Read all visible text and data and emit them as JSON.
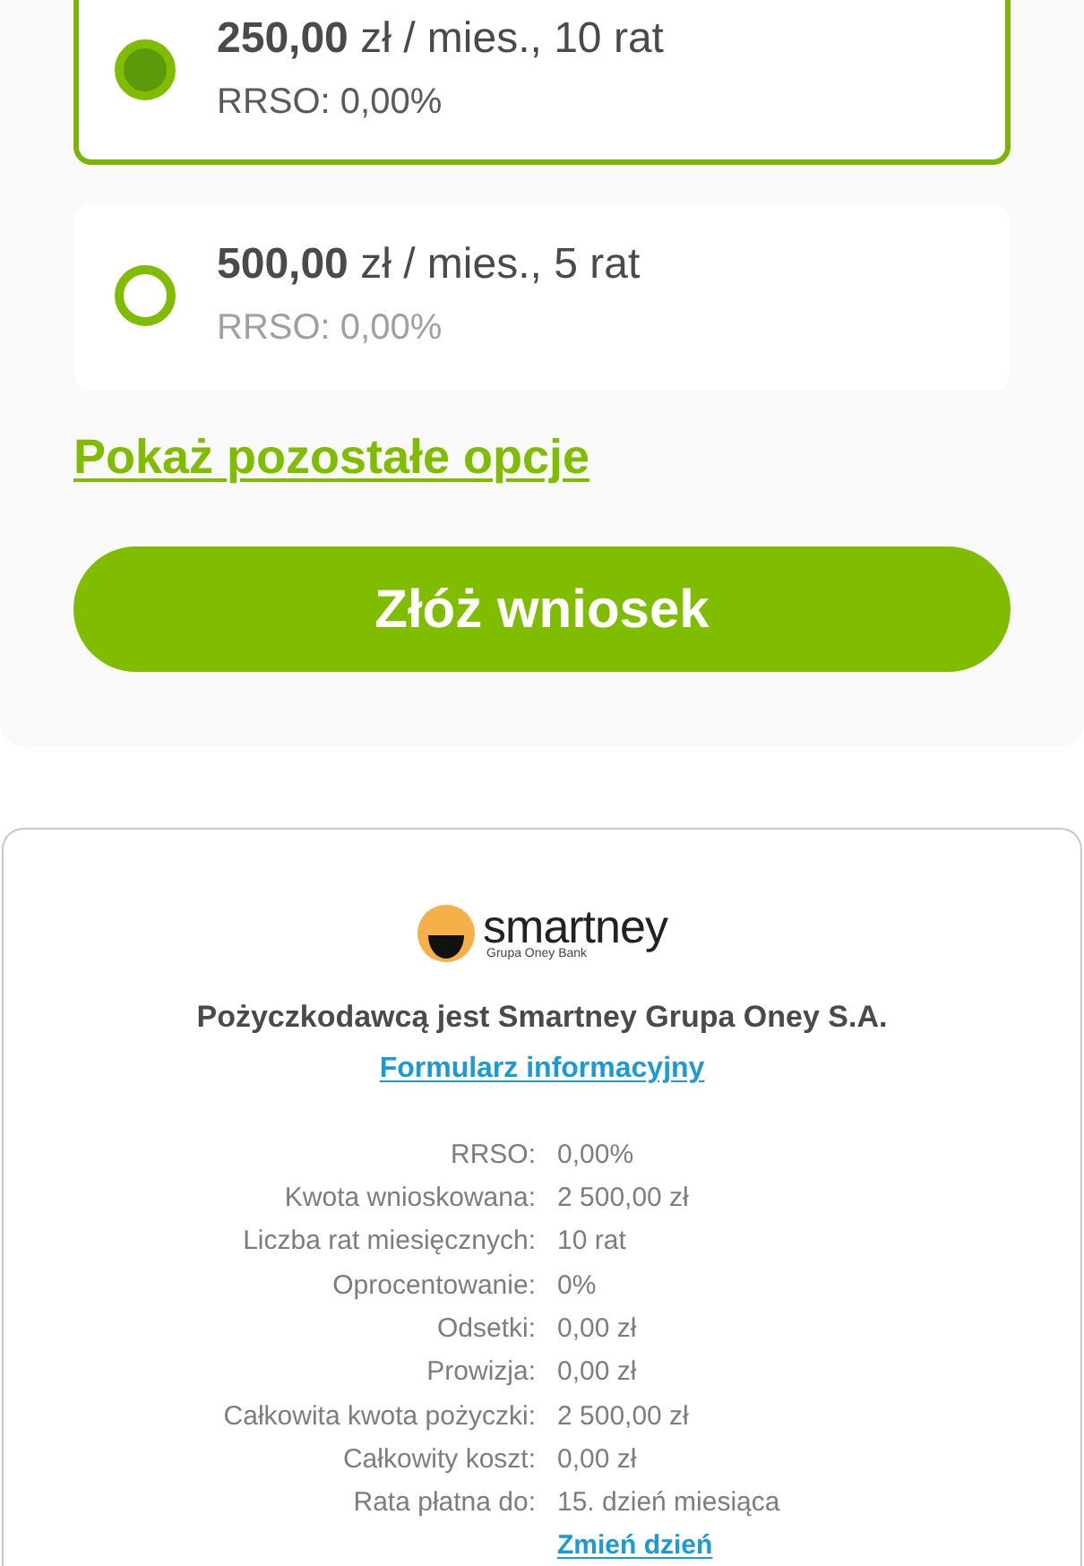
{
  "installment_options": [
    {
      "label": "**250,00** zł / mies., 10 rat",
      "rrso": "RRSO: 0,00%",
      "selected": true
    },
    {
      "label": "**500,00** zł / mies., 5 rat",
      "rrso": "RRSO: 0,00%",
      "selected": false
    }
  ],
  "show_more_link": "Pokaż pozostałe opcje",
  "submit_button": "Złóż wniosek",
  "lender": {
    "logo_name": "smartney",
    "logo_tagline": "Grupa Oney Bank",
    "statement": "Pożyczkodawcą jest Smartney Grupa Oney S.A.",
    "form_link": "Formularz informacyjny"
  },
  "summary": [
    {
      "label": "RRSO:",
      "value": "0,00%"
    },
    {
      "label": "Kwota wnioskowana:",
      "value": "2 500,00 zł"
    },
    {
      "label": "Liczba rat miesięcznych:",
      "value": "10 rat"
    },
    {
      "label": "Oprocentowanie:",
      "value": "0%"
    },
    {
      "label": "Odsetki:",
      "value": "0,00 zł"
    },
    {
      "label": "Prowizja:",
      "value": "0,00 zł"
    },
    {
      "label": "Całkowita kwota pożyczki:",
      "value": "2 500,00 zł"
    },
    {
      "label": "Całkowity koszt:",
      "value": "0,00 zł"
    },
    {
      "label": "Rata płatna do:",
      "value": "15. dzień miesiąca"
    }
  ],
  "change_day_link": "Zmień dzień"
}
